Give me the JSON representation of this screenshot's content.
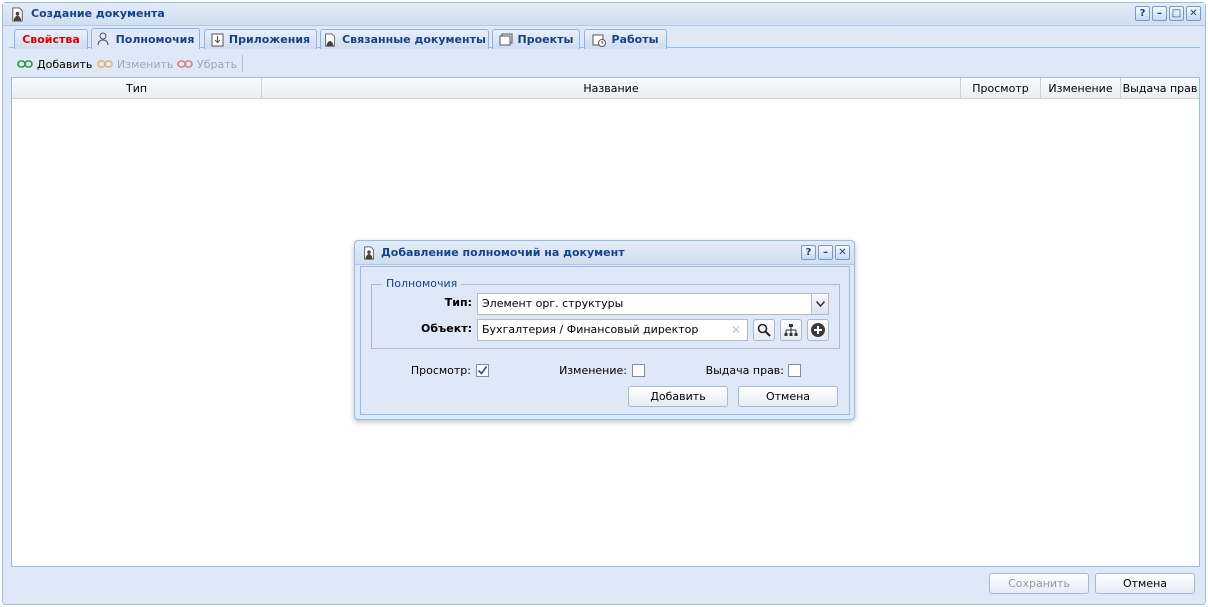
{
  "window": {
    "title": "Создание документа",
    "tools": [
      "?",
      "–",
      "□",
      "✕"
    ]
  },
  "tabs": [
    {
      "label": "Свойства"
    },
    {
      "label": "Полномочия"
    },
    {
      "label": "Приложения"
    },
    {
      "label": "Связанные документы"
    },
    {
      "label": "Проекты"
    },
    {
      "label": "Работы"
    }
  ],
  "toolbar": {
    "add_label": "Добавить",
    "edit_label": "Изменить",
    "remove_label": "Убрать"
  },
  "grid": {
    "columns": [
      "Тип",
      "Название",
      "Просмотр",
      "Изменение",
      "Выдача прав"
    ]
  },
  "footer": {
    "save_label": "Сохранить",
    "cancel_label": "Отмена"
  },
  "dialog": {
    "title": "Добавление полномочий на документ",
    "tools": [
      "?",
      "–",
      "✕"
    ],
    "fieldset_legend": "Полномочия",
    "type_label": "Тип:",
    "type_value": "Элемент орг. структуры",
    "object_label": "Объект:",
    "object_value": "Бухгалтерия / Финансовый директор",
    "view_label": "Просмотр:",
    "view_checked": true,
    "edit_label": "Изменение:",
    "edit_checked": false,
    "grant_label": "Выдача прав:",
    "grant_checked": false,
    "add_label": "Добавить",
    "cancel_label": "Отмена"
  },
  "colors": {
    "panel_bg": "#dfe8f6",
    "border": "#99bbe8",
    "title_text": "#15428b",
    "active_tab_text": "#dd0000"
  }
}
